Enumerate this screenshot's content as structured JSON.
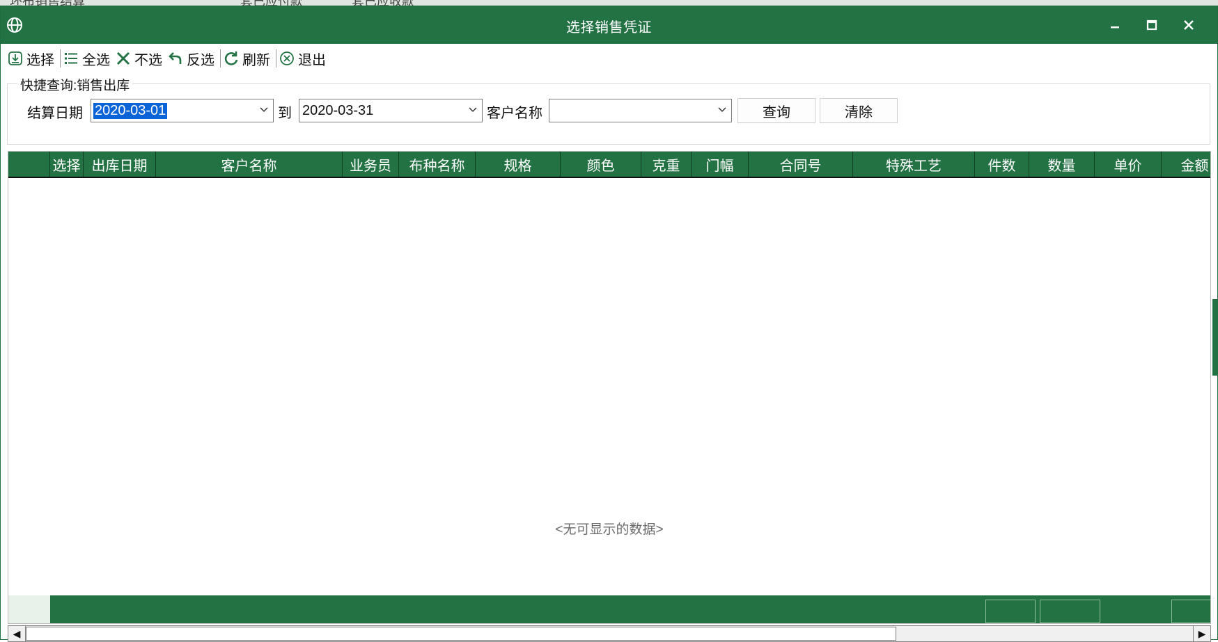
{
  "background_app": {
    "tabs": [
      "坯布销售结算",
      "套已应付款",
      "套已应收款"
    ]
  },
  "window": {
    "title": "选择销售凭证",
    "icon": "globe-icon",
    "controls": {
      "minimize": "minimize-icon",
      "maximize": "maximize-icon",
      "close": "close-icon"
    }
  },
  "toolbar": {
    "items": [
      {
        "label": "选择",
        "icon": "download-icon"
      },
      {
        "label": "全选",
        "icon": "list-icon"
      },
      {
        "label": "不选",
        "icon": "x-icon"
      },
      {
        "label": "反选",
        "icon": "undo-icon"
      },
      {
        "label": "刷新",
        "icon": "refresh-icon"
      },
      {
        "label": "退出",
        "icon": "circle-x-icon"
      }
    ]
  },
  "quick_query": {
    "legend": "快捷查询:销售出库",
    "settle_date_label": "结算日期",
    "date_from": "2020-03-01",
    "to_label": "到",
    "date_to": "2020-03-31",
    "customer_label": "客户名称",
    "customer_value": "",
    "query_button": "查询",
    "clear_button": "清除"
  },
  "grid": {
    "columns": [
      "",
      "选择",
      "出库日期",
      "客户名称",
      "业务员",
      "布种名称",
      "规格",
      "颜色",
      "克重",
      "门幅",
      "合同号",
      "特殊工艺",
      "件数",
      "数量",
      "单价",
      "金额"
    ],
    "rows": [],
    "empty_text": "<无可显示的数据>"
  },
  "colors": {
    "accent": "#237244",
    "selection": "#0a64d8"
  }
}
